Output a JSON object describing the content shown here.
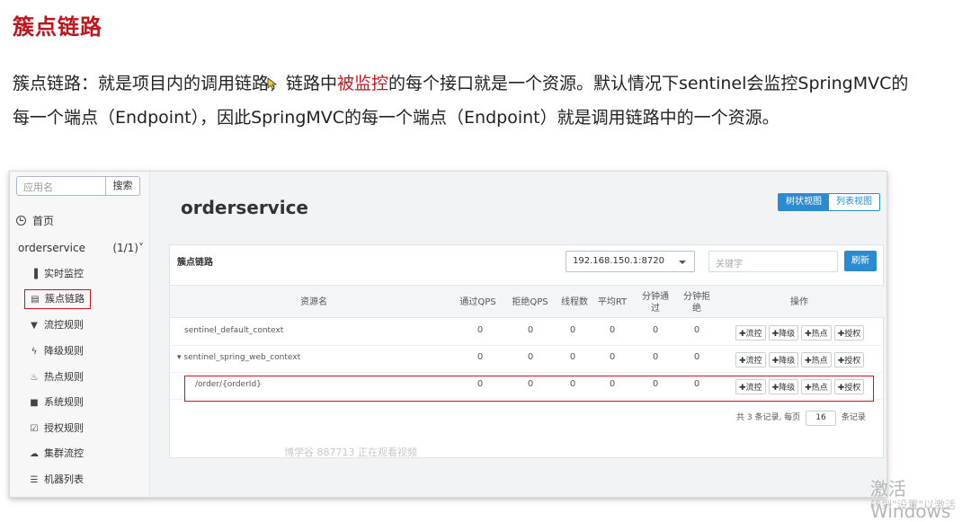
{
  "doc": {
    "title": "簇点链路",
    "para_line1_a": "簇点链路：就是项目内的调用链路，链路中",
    "para_line1_hl": "被监控",
    "para_line1_b": "的每个接口就是一个资源。默认情况下sentinel会监控SpringMVC的",
    "para_line2": "每一个端点（Endpoint），因此SpringMVC的每一个端点（Endpoint）就是调用链路中的一个资源。",
    "highlight_color": "#d0121b"
  },
  "sidebar": {
    "search_placeholder": "应用名",
    "search_button": "搜索",
    "home": "首页",
    "app_name": "orderservice",
    "app_count": "(1/1)",
    "items": [
      {
        "label": "实时监控",
        "icon": "bar-chart-icon"
      },
      {
        "label": "簇点链路",
        "icon": "list-icon"
      },
      {
        "label": "流控规则",
        "icon": "filter-icon"
      },
      {
        "label": "降级规则",
        "icon": "bolt-icon"
      },
      {
        "label": "热点规则",
        "icon": "fire-icon"
      },
      {
        "label": "系统规则",
        "icon": "lock-icon"
      },
      {
        "label": "授权规则",
        "icon": "check-circle-icon"
      },
      {
        "label": "集群流控",
        "icon": "cloud-icon"
      },
      {
        "label": "机器列表",
        "icon": "list-ul-icon"
      }
    ]
  },
  "main": {
    "title": "orderservice",
    "view_tree": "树状视图",
    "view_list": "列表视图",
    "panel_label": "簇点链路",
    "machine": "192.168.150.1:8720",
    "keyword_placeholder": "关键字",
    "refresh": "刷新",
    "columns": [
      "资源名",
      "通过QPS",
      "拒绝QPS",
      "线程数",
      "平均RT",
      "分钟通过",
      "分钟拒绝",
      "操作"
    ],
    "rows": [
      {
        "name": "sentinel_default_context",
        "values": [
          "0",
          "0",
          "0",
          "0",
          "0",
          "0"
        ]
      },
      {
        "name": "▾ sentinel_spring_web_context",
        "values": [
          "0",
          "0",
          "0",
          "0",
          "0",
          "0"
        ]
      },
      {
        "name": "/order/{orderId}",
        "values": [
          "0",
          "0",
          "0",
          "0",
          "0",
          "0"
        ]
      }
    ],
    "ops": [
      "流控",
      "降级",
      "热点",
      "授权"
    ],
    "pager_prefix": "共 3 条记录, 每页",
    "page_size": "16",
    "pager_suffix": "条记录",
    "watermark": "博学谷 887713 正在观看视频"
  },
  "windows": {
    "activate": "激活 Windows",
    "activate_sub": "转到\"设置\"以激活"
  }
}
